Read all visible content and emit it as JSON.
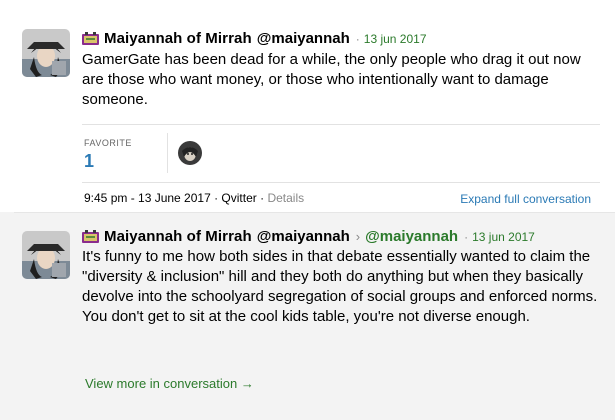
{
  "post1": {
    "author": "Maiyannah of Mirrah",
    "handle": "@maiyannah",
    "separator": "·",
    "date": "13 jun 2017",
    "text": "GamerGate has been dead for a while, the only people who drag it out now are those who want money, or those who intentionally want to damage someone.",
    "favorite_label": "FAVORITE",
    "favorite_count": "1",
    "timestamp": "9:45 pm - 13 June 2017 · Qvitter ·",
    "details_label": "Details",
    "expand_label": "Expand full conversation"
  },
  "post2": {
    "author": "Maiyannah of Mirrah",
    "handle": "@maiyannah",
    "reply_arrow": "›",
    "reply_to": "@maiyannah",
    "separator": "·",
    "date": "13 jun 2017",
    "text": "It's funny to me how both sides in that debate essentially wanted to claim the \"diversity & inclusion\" hill and they both do anything but when they basically devolve into the schoolyard segregation of social groups and enforced norms.  You don't get to sit at the cool kids table, you're not diverse enough.",
    "view_more_label": "View more in conversation →"
  },
  "colors": {
    "link_blue": "#2b7ab5",
    "date_green": "#2b7a2b",
    "reply_bg": "#f3f3f3"
  }
}
